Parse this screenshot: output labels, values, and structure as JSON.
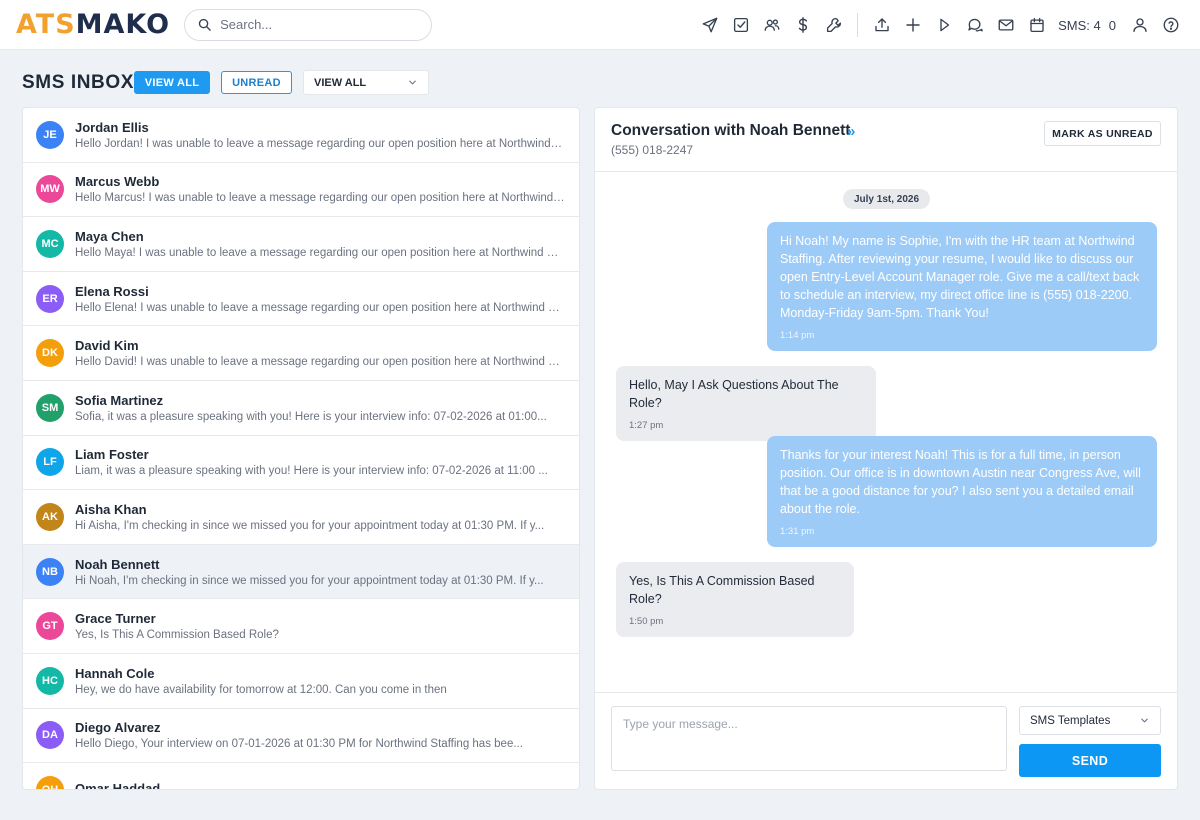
{
  "header": {
    "logo_part1": "ATS",
    "logo_part2": "MAKO",
    "search_placeholder": "Search...",
    "icons": [
      "send-icon",
      "checkbox-icon",
      "users-icon",
      "dollar-icon",
      "wrench-icon",
      "upload-icon",
      "plus-icon",
      "play-icon",
      "chat-icon",
      "mail-icon",
      "calendar-icon",
      "user-icon",
      "help-icon"
    ],
    "sms_label": "SMS: 4",
    "extra_count": "0"
  },
  "inbox": {
    "title": "SMS INBOX",
    "view_all_button": "VIEW ALL",
    "unread_button": "UNREAD",
    "filter_value": "VIEW ALL"
  },
  "conversations": [
    {
      "initials": "JE",
      "name": "Jordan Ellis",
      "preview": "Hello Jordan! I was unable to leave a message regarding our open position here at Northwind Sta...",
      "color": "#3b82f6"
    },
    {
      "initials": "MW",
      "name": "Marcus Webb",
      "preview": "Hello Marcus! I was unable to leave a message regarding our open position here at Northwind S...",
      "color": "#ec4899"
    },
    {
      "initials": "MC",
      "name": "Maya Chen",
      "preview": "Hello Maya! I was unable to leave a message regarding our open position here at Northwind Sta...",
      "color": "#14b8a6"
    },
    {
      "initials": "ER",
      "name": "Elena Rossi",
      "preview": "Hello Elena! I was unable to leave a message regarding our open position here at Northwind Sta...",
      "color": "#8b5cf6"
    },
    {
      "initials": "DK",
      "name": "David Kim",
      "preview": "Hello David! I was unable to leave a message regarding our open position here at Northwind Sta...",
      "color": "#f59e0b"
    },
    {
      "initials": "SM",
      "name": "Sofia Martinez",
      "preview": "Sofia, it was a pleasure speaking with you! Here is your interview info: 07-02-2026 at 01:00...",
      "color": "#22a06b"
    },
    {
      "initials": "LF",
      "name": "Liam Foster",
      "preview": "Liam, it was a pleasure speaking with you! Here is your interview info: 07-02-2026 at 11:00 ...",
      "color": "#0ea5e9"
    },
    {
      "initials": "AK",
      "name": "Aisha Khan",
      "preview": "Hi Aisha, I'm checking in since we missed you for your appointment today at 01:30 PM. If y...",
      "color": "#c2851a"
    },
    {
      "initials": "NB",
      "name": "Noah Bennett",
      "preview": "Hi Noah, I'm checking in since we missed you for your appointment today at 01:30 PM. If y...",
      "color": "#3b82f6"
    },
    {
      "initials": "GT",
      "name": "Grace Turner",
      "preview": "Yes, Is This A Commission Based Role?",
      "color": "#ec4899"
    },
    {
      "initials": "HC",
      "name": "Hannah Cole",
      "preview": "Hey, we do have availability for tomorrow at 12:00. Can you come in then",
      "color": "#14b8a6"
    },
    {
      "initials": "DA",
      "name": "Diego Alvarez",
      "preview": "Hello Diego, Your interview on 07-01-2026 at 01:30 PM for Northwind Staffing has bee...",
      "color": "#8b5cf6"
    },
    {
      "initials": "OH",
      "name": "Omar Haddad",
      "preview": "",
      "color": "#f59e0b"
    }
  ],
  "conversation": {
    "title": "Conversation with Noah Bennett",
    "expand_glyph": "»",
    "phone": "(555) 018-2247",
    "mark_unread_button": "MARK AS UNREAD",
    "date": "July 1st, 2026",
    "messages": [
      {
        "direction": "out",
        "text": "Hi Noah! My name is Sophie, I'm with the HR team at Northwind Staffing. After reviewing your resume, I would like to discuss our open Entry-Level Account Manager role. Give me a call/text back to schedule an interview, my direct office line is (555) 018-2200. Monday-Friday 9am-5pm. Thank You!",
        "time": "1:14 pm"
      },
      {
        "direction": "in",
        "text": "Hello, May I Ask Questions About The Role?",
        "time": "1:27 pm"
      },
      {
        "direction": "out",
        "text": "Thanks for your interest Noah! This is for a full time, in person position. Our office is in downtown Austin near Congress Ave, will that be a good distance for you? I also sent you a detailed email about the role.",
        "time": "1:31 pm"
      },
      {
        "direction": "in",
        "text": "Yes, Is This A Commission Based Role?",
        "time": "1:50 pm"
      }
    ],
    "message_placeholder": "Type your message...",
    "template_value": "SMS Templates",
    "send_button": "SEND"
  }
}
